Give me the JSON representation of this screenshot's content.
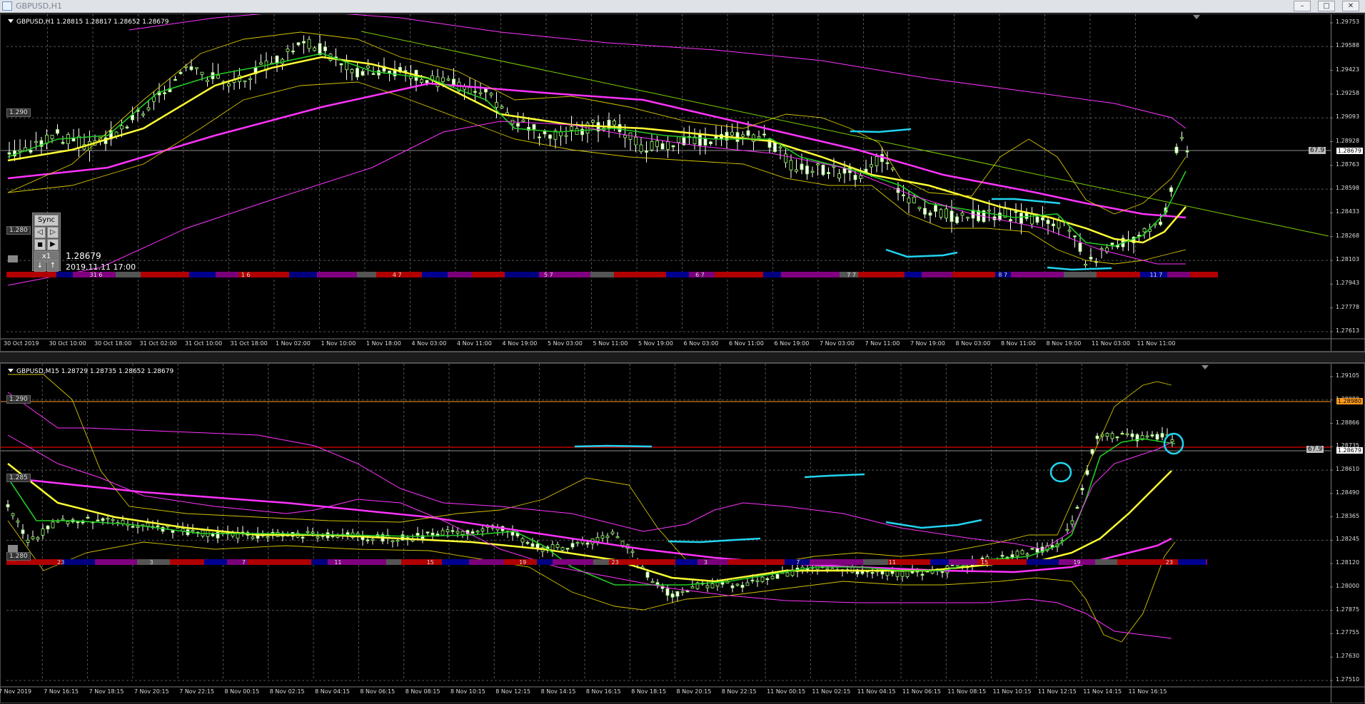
{
  "window": {
    "title": "GBPUSD,H1",
    "min_label": "–",
    "max_label": "□",
    "close_label": "✕"
  },
  "chart1": {
    "header": "GBPUSD,H1  1.28815 1.28817 1.28652 1.28679",
    "prices": [
      "1.29753",
      "1.29588",
      "1.29423",
      "1.29258",
      "1.29093",
      "1.28928",
      "1.28763",
      "1.28598",
      "1.28433",
      "1.28268",
      "1.28103",
      "1.27943",
      "1.27778",
      "1.27613"
    ],
    "current_price": "1.28679",
    "level_labels": [
      "1.290",
      "1.280"
    ],
    "value_tag": "67.9",
    "times": [
      "30 Oct 2019",
      "30 Oct 10:00",
      "30 Oct 18:00",
      "31 Oct 02:00",
      "31 Oct 10:00",
      "31 Oct 18:00",
      "1 Nov 02:00",
      "1 Nov 10:00",
      "1 Nov 18:00",
      "4 Nov 03:00",
      "4 Nov 11:00",
      "4 Nov 19:00",
      "5 Nov 03:00",
      "5 Nov 11:00",
      "5 Nov 19:00",
      "6 Nov 03:00",
      "6 Nov 11:00",
      "6 Nov 19:00",
      "7 Nov 03:00",
      "7 Nov 11:00",
      "7 Nov 19:00",
      "8 Nov 03:00",
      "8 Nov 11:00",
      "8 Nov 19:00",
      "11 Nov 03:00",
      "11 Nov 11:00"
    ],
    "bar_labels": [
      "31 6",
      "1 6",
      "4 7",
      "5 7",
      "6 7",
      "7 7",
      "8 7",
      "11 7"
    ],
    "sync": {
      "title": "Sync",
      "speed": "x1",
      "info_price": "1.28679",
      "info_time": "2019.11.11 17:00"
    }
  },
  "chart2": {
    "header": "GBPUSD,M15  1.28729 1.28735 1.28652 1.28679",
    "prices": [
      "1.29105",
      "1.28980",
      "1.28866",
      "1.28735",
      "1.28610",
      "1.28490",
      "1.28365",
      "1.28245",
      "1.28120",
      "1.28000",
      "1.27875",
      "1.27755",
      "1.27630",
      "1.27510"
    ],
    "current_price": "1.28679",
    "orange_price": "1.28980",
    "level_labels": [
      "1.290",
      "1.285",
      "1.280"
    ],
    "value_tag": "67.9",
    "times": [
      "7 Nov 2019",
      "7 Nov 16:15",
      "7 Nov 18:15",
      "7 Nov 20:15",
      "7 Nov 22:15",
      "8 Nov 00:15",
      "8 Nov 02:15",
      "8 Nov 04:15",
      "8 Nov 06:15",
      "8 Nov 08:15",
      "8 Nov 10:15",
      "8 Nov 12:15",
      "8 Nov 14:15",
      "8 Nov 16:15",
      "8 Nov 18:15",
      "8 Nov 20:15",
      "8 Nov 22:15",
      "11 Nov 00:15",
      "11 Nov 02:15",
      "11 Nov 04:15",
      "11 Nov 06:15",
      "11 Nov 08:15",
      "11 Nov 10:15",
      "11 Nov 12:15",
      "11 Nov 14:15",
      "11 Nov 16:15"
    ],
    "bar_labels": [
      "23",
      "3",
      "7",
      "11",
      "15",
      "19",
      "23",
      "3",
      "7",
      "11",
      "15",
      "19",
      "23"
    ]
  },
  "colors": {
    "background": "#000000",
    "yellow_ma": "#ffff33",
    "green_ma": "#22cc22",
    "magenta_ma": "#ff33ff",
    "bands": "#d4c400",
    "cyan_marks": "#22d4f0",
    "candle": "#ffffff"
  }
}
